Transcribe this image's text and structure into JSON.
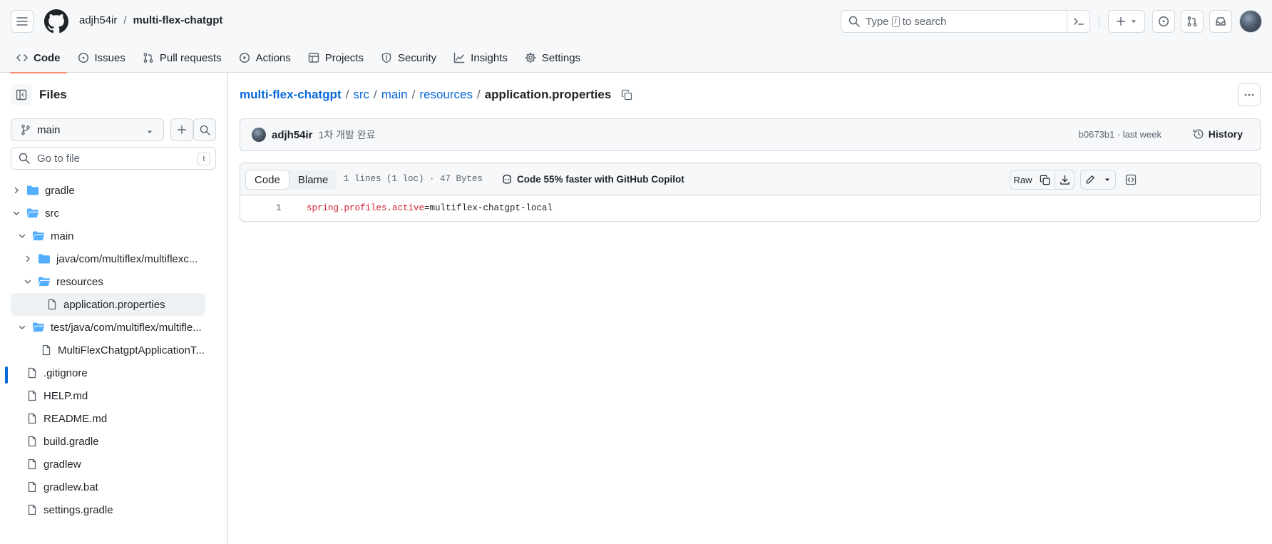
{
  "header": {
    "owner": "adjh54ir",
    "separator": "/",
    "repo": "multi-flex-chatgpt",
    "search_prefix": "Type",
    "search_key": "/",
    "search_suffix": "to search"
  },
  "tabs": [
    {
      "label": "Code",
      "icon": "code-icon",
      "active": true
    },
    {
      "label": "Issues",
      "icon": "issue-opened-icon"
    },
    {
      "label": "Pull requests",
      "icon": "git-pull-request-icon"
    },
    {
      "label": "Actions",
      "icon": "play-icon"
    },
    {
      "label": "Projects",
      "icon": "table-icon"
    },
    {
      "label": "Security",
      "icon": "shield-icon"
    },
    {
      "label": "Insights",
      "icon": "graph-icon"
    },
    {
      "label": "Settings",
      "icon": "gear-icon"
    }
  ],
  "sidebar": {
    "title": "Files",
    "branch": "main",
    "go_to_file_placeholder": "Go to file",
    "go_to_file_key": "t",
    "tree": [
      {
        "label": "gradle",
        "type": "folder",
        "expanded": false
      },
      {
        "label": "src",
        "type": "folder",
        "expanded": true
      },
      {
        "label": "main",
        "type": "folder",
        "expanded": true
      },
      {
        "label": "java/com/multiflex/multiflexc...",
        "type": "folder",
        "expanded": false
      },
      {
        "label": "resources",
        "type": "folder",
        "expanded": true
      },
      {
        "label": "application.properties",
        "type": "file",
        "selected": true
      },
      {
        "label": "test/java/com/multiflex/multifle...",
        "type": "folder",
        "expanded": true
      },
      {
        "label": "MultiFlexChatgptApplicationT...",
        "type": "file"
      },
      {
        "label": ".gitignore",
        "type": "file"
      },
      {
        "label": "HELP.md",
        "type": "file"
      },
      {
        "label": "README.md",
        "type": "file"
      },
      {
        "label": "build.gradle",
        "type": "file"
      },
      {
        "label": "gradlew",
        "type": "file"
      },
      {
        "label": "gradlew.bat",
        "type": "file"
      },
      {
        "label": "settings.gradle",
        "type": "file"
      }
    ]
  },
  "breadcrumb": {
    "parts": [
      "multi-flex-chatgpt",
      "src",
      "main",
      "resources"
    ],
    "separator": "/",
    "current": "application.properties"
  },
  "commit": {
    "author": "adjh54ir",
    "message": "1차 개발 완료",
    "meta": "b0673b1 · last week",
    "history_label": "History"
  },
  "file": {
    "tab_code": "Code",
    "tab_blame": "Blame",
    "info": "1 lines (1 loc) · 47 Bytes",
    "copilot": "Code 55% faster with GitHub Copilot",
    "raw_label": "Raw",
    "line_number": "1",
    "line_key": "spring.profiles.active",
    "line_value": "=multiflex-chatgpt-local"
  },
  "colors": {
    "accent_blue": "#0969da",
    "tab_underline": "#fd8c73",
    "folder": "#54aeff",
    "code_key": "#cf222e"
  }
}
